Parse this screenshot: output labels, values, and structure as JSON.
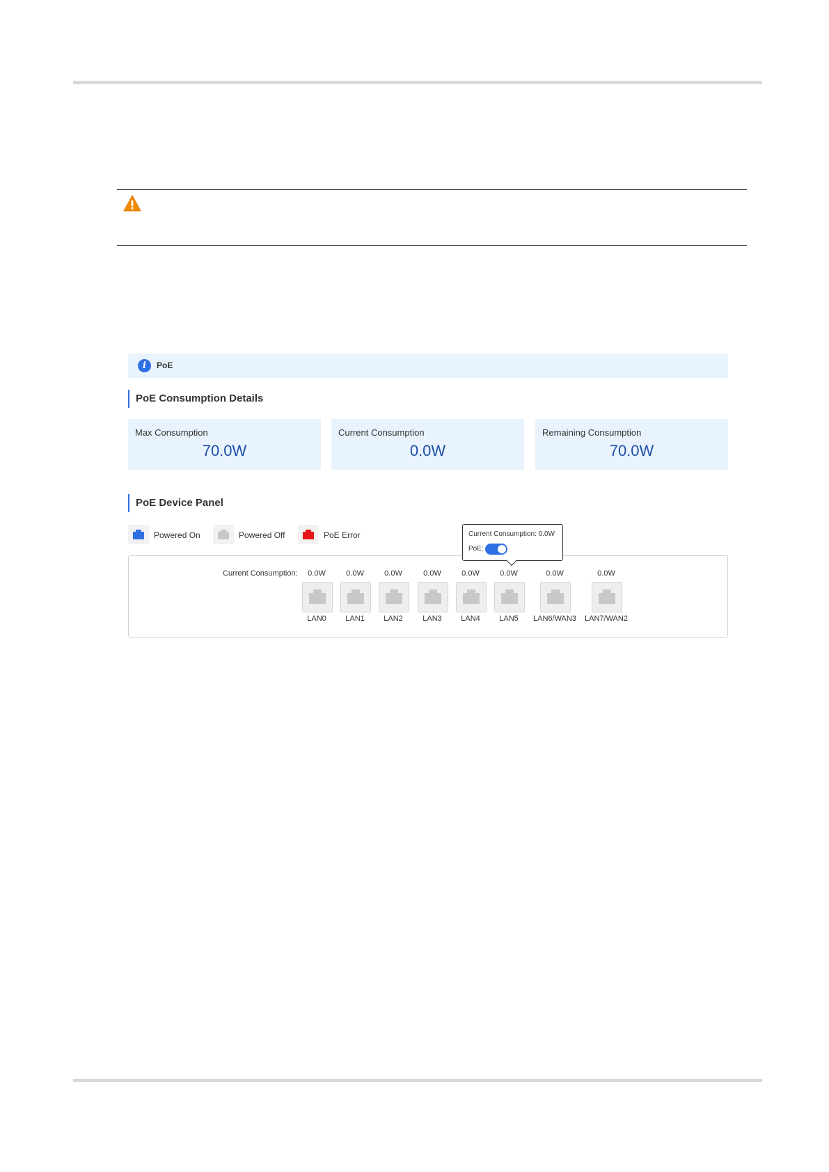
{
  "colors": {
    "accent": "#2f6fe4",
    "card_bg": "#e8f3fd",
    "value_text": "#1d4fa8",
    "powered_on": "#2f6fe4",
    "powered_off": "#c8c8c8",
    "poe_error": "#e8141b",
    "warning": "#f08a00"
  },
  "info_bar": {
    "icon": "info-icon",
    "text": "PoE"
  },
  "consumption": {
    "title": "PoE Consumption Details",
    "cards": [
      {
        "label": "Max Consumption",
        "value": "70.0W"
      },
      {
        "label": "Current Consumption",
        "value": "0.0W"
      },
      {
        "label": "Remaining Consumption",
        "value": "70.0W"
      }
    ]
  },
  "device_panel": {
    "title": "PoE Device Panel",
    "legend": [
      {
        "label": "Powered On",
        "icon": "port-icon-blue"
      },
      {
        "label": "Powered Off",
        "icon": "port-icon-gray"
      },
      {
        "label": "PoE Error",
        "icon": "port-icon-red"
      }
    ],
    "tooltip": {
      "consumption_text": "Current Consumption: 0.0W",
      "poe_label": "PoE:",
      "poe_enabled": true
    },
    "current_consumption_label": "Current Consumption:",
    "ports": [
      {
        "name": "LAN0",
        "value": "0.0W"
      },
      {
        "name": "LAN1",
        "value": "0.0W"
      },
      {
        "name": "LAN2",
        "value": "0.0W"
      },
      {
        "name": "LAN3",
        "value": "0.0W"
      },
      {
        "name": "LAN4",
        "value": "0.0W"
      },
      {
        "name": "LAN5",
        "value": "0.0W"
      },
      {
        "name": "LAN6/WAN3",
        "value": "0.0W"
      },
      {
        "name": "LAN7/WAN2",
        "value": "0.0W"
      }
    ]
  }
}
